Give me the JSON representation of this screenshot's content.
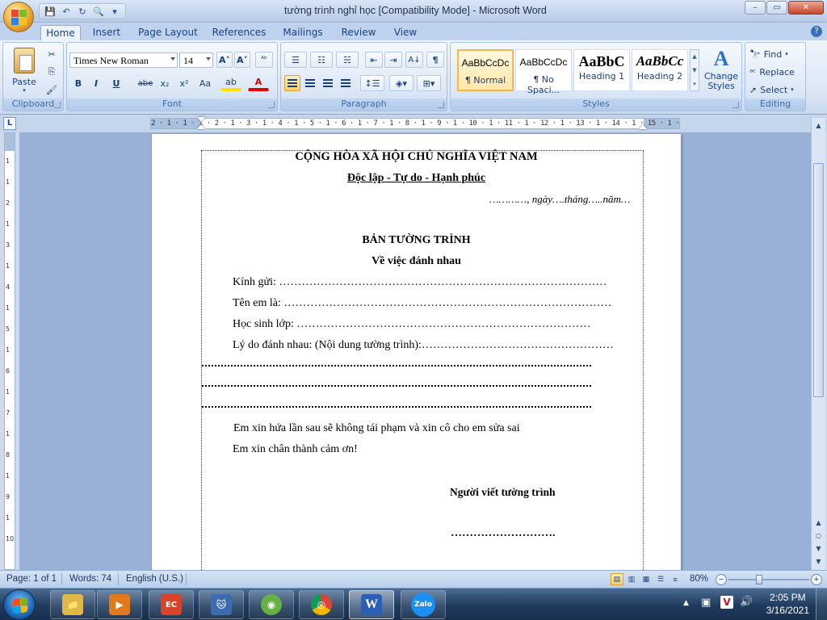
{
  "window": {
    "title": "tường trình nghỉ học [Compatibility Mode] - Microsoft Word",
    "controls": {
      "minimize": "–",
      "maximize": "▭",
      "close": "✕"
    }
  },
  "quick_access": {
    "save": "💾",
    "undo": "↶",
    "redo": "↻",
    "print_preview": "🔍",
    "more": "▾"
  },
  "tabs": [
    "Home",
    "Insert",
    "Page Layout",
    "References",
    "Mailings",
    "Review",
    "View"
  ],
  "active_tab": "Home",
  "ribbon": {
    "clipboard": {
      "label": "Clipboard",
      "paste": "Paste",
      "cut": "✂",
      "copy": "⎘",
      "format_painter": "🖌"
    },
    "font": {
      "label": "Font",
      "family": "Times New Roman",
      "size": "14",
      "grow": "A˄",
      "shrink": "A˅",
      "clear": "ᴬᵇ",
      "bold": "B",
      "italic": "I",
      "underline": "U",
      "strike": "abe",
      "subscript": "x₂",
      "superscript": "x²",
      "change_case": "Aa",
      "highlight": "ab",
      "font_color": "A"
    },
    "paragraph": {
      "label": "Paragraph",
      "bullets": "☰",
      "numbering": "☷",
      "multilevel": "☵",
      "decrease_indent": "⇤",
      "increase_indent": "⇥",
      "sort": "A↓",
      "show_marks": "¶"
    },
    "styles": {
      "label": "Styles",
      "items": [
        {
          "sample": "AaBbCcDc",
          "name": "¶ Normal",
          "selected": true
        },
        {
          "sample": "AaBbCcDc",
          "name": "¶ No Spaci...",
          "selected": false
        },
        {
          "sample": "AaBbC",
          "name": "Heading 1",
          "selected": false
        },
        {
          "sample": "AaBbCc",
          "name": "Heading 2",
          "selected": false
        }
      ],
      "change_styles": "Change Styles"
    },
    "editing": {
      "label": "Editing",
      "find": "Find",
      "replace": "Replace",
      "select": "Select"
    }
  },
  "ruler": {
    "ticks": "2 · 1 · 1 · 1 · 2 · 1 · 3 · 1 · 4 · 1 · 5 · 1 · 6 · 1 · 7 · 1 · 8 · 1 · 9 · 1 · 10 · 1 · 11 · 1 · 12 · 1 · 13 · 1 · 14 · 1 · 15 · 1 · 16 · 1 · 17 · 1 ·   · 19 · 1",
    "tab_selector": "L"
  },
  "document": {
    "national_title": "CỘNG HÒA XÃ HỘI CHỦ NGHĨA VIỆT NAM",
    "motto": "Độc lập - Tự do - Hạnh phúc",
    "date_line": "…………, ngày….tháng…..năm…",
    "doc_title": "BẢN TƯỜNG TRÌNH",
    "subject": "Về việc đánh nhau",
    "to_label": "Kính gửi: ……………………………………………………………………………",
    "name_label": "Tên em là: ……………………………………………………………………………",
    "class_label": "Học sinh lớp: ……………………………………………………………………",
    "reason_label": "Lý do đánh nhau: (Nội dung tường trình):……………………………………………",
    "promise": "Em xin hứa lần sau sẽ không tái phạm và xin cô cho em sửa sai",
    "thanks": "Em xin chân thành cảm ơn!",
    "signer": "Người viết tường trình",
    "signature_line": "………………………."
  },
  "statusbar": {
    "page": "Page: 1 of 1",
    "words": "Words: 74",
    "language": "English (U.S.)",
    "zoom": "80%",
    "zoom_out": "−",
    "zoom_in": "+"
  },
  "taskbar": {
    "apps": [
      {
        "name": "file-explorer",
        "glyph": "📁",
        "color": "#e0b84a"
      },
      {
        "name": "media-player",
        "glyph": "▶",
        "color": "#e07a1c"
      },
      {
        "name": "presentation-app",
        "glyph": "EC",
        "color": "#d8442a"
      },
      {
        "name": "cat-app",
        "glyph": "🐱",
        "color": "#3b6bb0"
      },
      {
        "name": "coccoc-browser",
        "glyph": "◉",
        "color": "#67b045"
      },
      {
        "name": "chrome-browser",
        "glyph": "◎",
        "color": "#db4437"
      },
      {
        "name": "word",
        "glyph": "W",
        "color": "#2b5fb4"
      },
      {
        "name": "zalo",
        "glyph": "Zalo",
        "color": "#1c8ef0"
      }
    ],
    "clock_time": "2:05 PM",
    "clock_date": "3/16/2021",
    "tray": {
      "up_arrow": "▲",
      "network": "▣",
      "antivirus": "V",
      "volume": "🔊"
    }
  },
  "colors": {
    "ribbon_bg": "#dbe7f6",
    "canvas_bg": "#99b1d6",
    "accent_orange": "#f2b84b"
  }
}
